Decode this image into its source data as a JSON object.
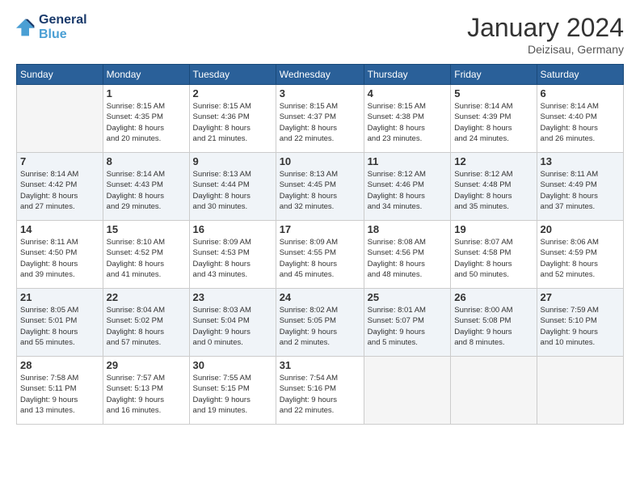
{
  "header": {
    "logo_line1": "General",
    "logo_line2": "Blue",
    "month": "January 2024",
    "location": "Deizisau, Germany"
  },
  "weekdays": [
    "Sunday",
    "Monday",
    "Tuesday",
    "Wednesday",
    "Thursday",
    "Friday",
    "Saturday"
  ],
  "weeks": [
    [
      {
        "day": "",
        "info": ""
      },
      {
        "day": "1",
        "info": "Sunrise: 8:15 AM\nSunset: 4:35 PM\nDaylight: 8 hours\nand 20 minutes."
      },
      {
        "day": "2",
        "info": "Sunrise: 8:15 AM\nSunset: 4:36 PM\nDaylight: 8 hours\nand 21 minutes."
      },
      {
        "day": "3",
        "info": "Sunrise: 8:15 AM\nSunset: 4:37 PM\nDaylight: 8 hours\nand 22 minutes."
      },
      {
        "day": "4",
        "info": "Sunrise: 8:15 AM\nSunset: 4:38 PM\nDaylight: 8 hours\nand 23 minutes."
      },
      {
        "day": "5",
        "info": "Sunrise: 8:14 AM\nSunset: 4:39 PM\nDaylight: 8 hours\nand 24 minutes."
      },
      {
        "day": "6",
        "info": "Sunrise: 8:14 AM\nSunset: 4:40 PM\nDaylight: 8 hours\nand 26 minutes."
      }
    ],
    [
      {
        "day": "7",
        "info": "Sunrise: 8:14 AM\nSunset: 4:42 PM\nDaylight: 8 hours\nand 27 minutes."
      },
      {
        "day": "8",
        "info": "Sunrise: 8:14 AM\nSunset: 4:43 PM\nDaylight: 8 hours\nand 29 minutes."
      },
      {
        "day": "9",
        "info": "Sunrise: 8:13 AM\nSunset: 4:44 PM\nDaylight: 8 hours\nand 30 minutes."
      },
      {
        "day": "10",
        "info": "Sunrise: 8:13 AM\nSunset: 4:45 PM\nDaylight: 8 hours\nand 32 minutes."
      },
      {
        "day": "11",
        "info": "Sunrise: 8:12 AM\nSunset: 4:46 PM\nDaylight: 8 hours\nand 34 minutes."
      },
      {
        "day": "12",
        "info": "Sunrise: 8:12 AM\nSunset: 4:48 PM\nDaylight: 8 hours\nand 35 minutes."
      },
      {
        "day": "13",
        "info": "Sunrise: 8:11 AM\nSunset: 4:49 PM\nDaylight: 8 hours\nand 37 minutes."
      }
    ],
    [
      {
        "day": "14",
        "info": "Sunrise: 8:11 AM\nSunset: 4:50 PM\nDaylight: 8 hours\nand 39 minutes."
      },
      {
        "day": "15",
        "info": "Sunrise: 8:10 AM\nSunset: 4:52 PM\nDaylight: 8 hours\nand 41 minutes."
      },
      {
        "day": "16",
        "info": "Sunrise: 8:09 AM\nSunset: 4:53 PM\nDaylight: 8 hours\nand 43 minutes."
      },
      {
        "day": "17",
        "info": "Sunrise: 8:09 AM\nSunset: 4:55 PM\nDaylight: 8 hours\nand 45 minutes."
      },
      {
        "day": "18",
        "info": "Sunrise: 8:08 AM\nSunset: 4:56 PM\nDaylight: 8 hours\nand 48 minutes."
      },
      {
        "day": "19",
        "info": "Sunrise: 8:07 AM\nSunset: 4:58 PM\nDaylight: 8 hours\nand 50 minutes."
      },
      {
        "day": "20",
        "info": "Sunrise: 8:06 AM\nSunset: 4:59 PM\nDaylight: 8 hours\nand 52 minutes."
      }
    ],
    [
      {
        "day": "21",
        "info": "Sunrise: 8:05 AM\nSunset: 5:01 PM\nDaylight: 8 hours\nand 55 minutes."
      },
      {
        "day": "22",
        "info": "Sunrise: 8:04 AM\nSunset: 5:02 PM\nDaylight: 8 hours\nand 57 minutes."
      },
      {
        "day": "23",
        "info": "Sunrise: 8:03 AM\nSunset: 5:04 PM\nDaylight: 9 hours\nand 0 minutes."
      },
      {
        "day": "24",
        "info": "Sunrise: 8:02 AM\nSunset: 5:05 PM\nDaylight: 9 hours\nand 2 minutes."
      },
      {
        "day": "25",
        "info": "Sunrise: 8:01 AM\nSunset: 5:07 PM\nDaylight: 9 hours\nand 5 minutes."
      },
      {
        "day": "26",
        "info": "Sunrise: 8:00 AM\nSunset: 5:08 PM\nDaylight: 9 hours\nand 8 minutes."
      },
      {
        "day": "27",
        "info": "Sunrise: 7:59 AM\nSunset: 5:10 PM\nDaylight: 9 hours\nand 10 minutes."
      }
    ],
    [
      {
        "day": "28",
        "info": "Sunrise: 7:58 AM\nSunset: 5:11 PM\nDaylight: 9 hours\nand 13 minutes."
      },
      {
        "day": "29",
        "info": "Sunrise: 7:57 AM\nSunset: 5:13 PM\nDaylight: 9 hours\nand 16 minutes."
      },
      {
        "day": "30",
        "info": "Sunrise: 7:55 AM\nSunset: 5:15 PM\nDaylight: 9 hours\nand 19 minutes."
      },
      {
        "day": "31",
        "info": "Sunrise: 7:54 AM\nSunset: 5:16 PM\nDaylight: 9 hours\nand 22 minutes."
      },
      {
        "day": "",
        "info": ""
      },
      {
        "day": "",
        "info": ""
      },
      {
        "day": "",
        "info": ""
      }
    ]
  ]
}
